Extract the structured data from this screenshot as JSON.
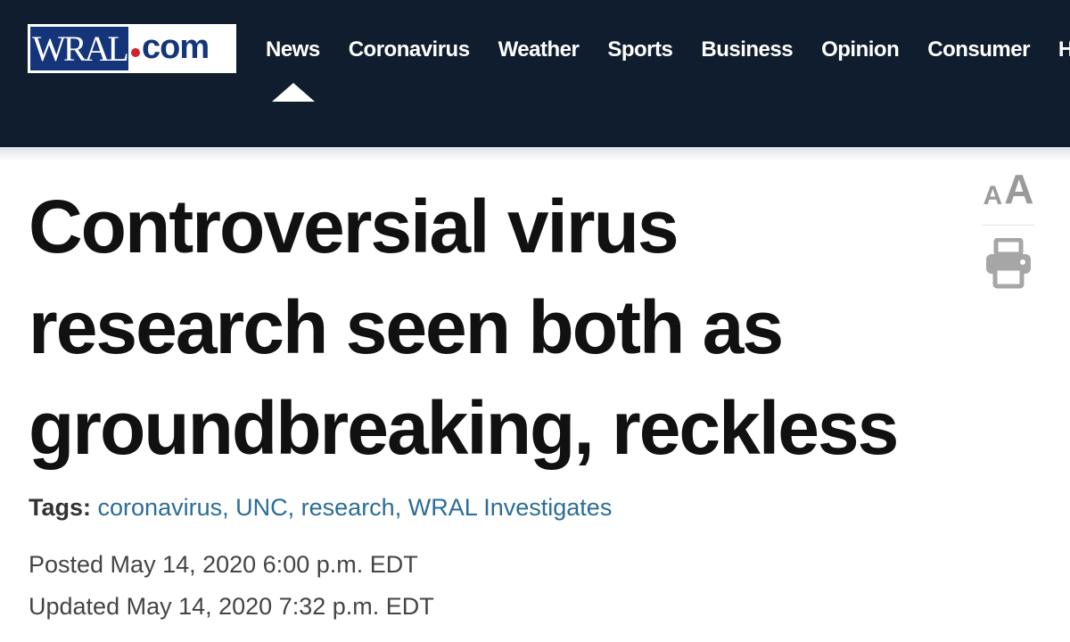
{
  "site": {
    "logo_wral": "WRAL",
    "logo_com": "com"
  },
  "nav": {
    "items": [
      {
        "label": "News"
      },
      {
        "label": "Coronavirus"
      },
      {
        "label": "Weather"
      },
      {
        "label": "Sports"
      },
      {
        "label": "Business"
      },
      {
        "label": "Opinion"
      },
      {
        "label": "Consumer"
      },
      {
        "label": "H"
      }
    ],
    "active": "News"
  },
  "article": {
    "headline": "Controversial virus research seen both as groundbreaking, reckless",
    "tags_label": "Tags:",
    "tags": [
      {
        "label": "coronavirus"
      },
      {
        "label": "UNC"
      },
      {
        "label": "research"
      },
      {
        "label": "WRAL Investigates"
      }
    ],
    "tag_separator": ",",
    "posted": "Posted May 14, 2020 6:00 p.m. EDT",
    "updated": "Updated May 14, 2020 7:32 p.m. EDT"
  },
  "tools": {
    "font_small": "A",
    "font_large": "A",
    "print_icon": "printer-icon"
  },
  "colors": {
    "header_bg": "#0f1d2e",
    "logo_blue": "#14357a",
    "logo_dot": "#d3202a",
    "tag_link": "#2b6d97"
  }
}
